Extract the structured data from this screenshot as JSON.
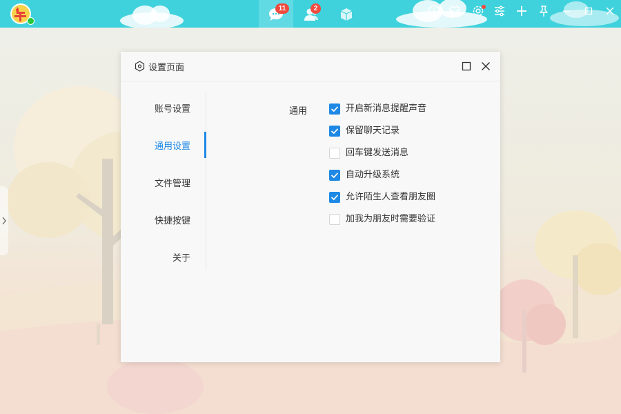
{
  "topbar": {
    "accent_color": "#3fd2dd",
    "logo": {
      "icon": "niu-logo-icon",
      "glyph": "牛",
      "status": "online"
    },
    "nav": [
      {
        "name": "chat",
        "icon": "chat-bubble-icon",
        "badge": "11",
        "active": true
      },
      {
        "name": "contacts",
        "icon": "contacts-icon",
        "badge": "2",
        "active": false
      },
      {
        "name": "apps",
        "icon": "cube-icon",
        "badge": "",
        "active": false
      }
    ],
    "tools": [
      {
        "icon": "info-icon"
      },
      {
        "icon": "shirt-icon"
      },
      {
        "icon": "settings-gear-icon",
        "notification_dot": true
      },
      {
        "icon": "sliders-icon"
      },
      {
        "icon": "plus-icon"
      },
      {
        "icon": "pin-icon"
      },
      {
        "icon": "minimize-icon"
      },
      {
        "icon": "maximize-icon"
      },
      {
        "icon": "close-icon"
      }
    ]
  },
  "dialog": {
    "title": "设置页面",
    "icon": "settings-hexagon-icon",
    "nav": [
      {
        "label": "账号设置",
        "active": false
      },
      {
        "label": "通用设置",
        "active": true
      },
      {
        "label": "文件管理",
        "active": false
      },
      {
        "label": "快捷按键",
        "active": false
      },
      {
        "label": "关于",
        "active": false
      }
    ],
    "section_label": "通用",
    "options": [
      {
        "label": "开启新消息提醒声音",
        "checked": true
      },
      {
        "label": "保留聊天记录",
        "checked": true
      },
      {
        "label": "回车键发送消息",
        "checked": false
      },
      {
        "label": "自动升级系统",
        "checked": true
      },
      {
        "label": "允许陌生人查看朋友圈",
        "checked": true
      },
      {
        "label": "加我为朋友时需要验证",
        "checked": false
      }
    ],
    "accent_color": "#1e88e5"
  },
  "edge_handle": {
    "icon": "chevron-right-icon"
  }
}
